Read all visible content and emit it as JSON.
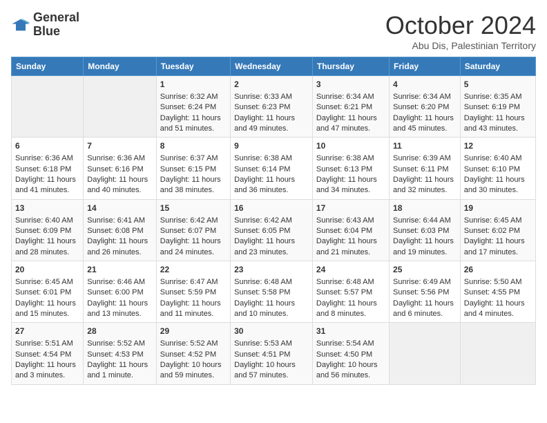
{
  "header": {
    "logo_line1": "General",
    "logo_line2": "Blue",
    "month": "October 2024",
    "location": "Abu Dis, Palestinian Territory"
  },
  "days_of_week": [
    "Sunday",
    "Monday",
    "Tuesday",
    "Wednesday",
    "Thursday",
    "Friday",
    "Saturday"
  ],
  "weeks": [
    [
      {
        "day": "",
        "info": ""
      },
      {
        "day": "",
        "info": ""
      },
      {
        "day": "1",
        "info": "Sunrise: 6:32 AM\nSunset: 6:24 PM\nDaylight: 11 hours and 51 minutes."
      },
      {
        "day": "2",
        "info": "Sunrise: 6:33 AM\nSunset: 6:23 PM\nDaylight: 11 hours and 49 minutes."
      },
      {
        "day": "3",
        "info": "Sunrise: 6:34 AM\nSunset: 6:21 PM\nDaylight: 11 hours and 47 minutes."
      },
      {
        "day": "4",
        "info": "Sunrise: 6:34 AM\nSunset: 6:20 PM\nDaylight: 11 hours and 45 minutes."
      },
      {
        "day": "5",
        "info": "Sunrise: 6:35 AM\nSunset: 6:19 PM\nDaylight: 11 hours and 43 minutes."
      }
    ],
    [
      {
        "day": "6",
        "info": "Sunrise: 6:36 AM\nSunset: 6:18 PM\nDaylight: 11 hours and 41 minutes."
      },
      {
        "day": "7",
        "info": "Sunrise: 6:36 AM\nSunset: 6:16 PM\nDaylight: 11 hours and 40 minutes."
      },
      {
        "day": "8",
        "info": "Sunrise: 6:37 AM\nSunset: 6:15 PM\nDaylight: 11 hours and 38 minutes."
      },
      {
        "day": "9",
        "info": "Sunrise: 6:38 AM\nSunset: 6:14 PM\nDaylight: 11 hours and 36 minutes."
      },
      {
        "day": "10",
        "info": "Sunrise: 6:38 AM\nSunset: 6:13 PM\nDaylight: 11 hours and 34 minutes."
      },
      {
        "day": "11",
        "info": "Sunrise: 6:39 AM\nSunset: 6:11 PM\nDaylight: 11 hours and 32 minutes."
      },
      {
        "day": "12",
        "info": "Sunrise: 6:40 AM\nSunset: 6:10 PM\nDaylight: 11 hours and 30 minutes."
      }
    ],
    [
      {
        "day": "13",
        "info": "Sunrise: 6:40 AM\nSunset: 6:09 PM\nDaylight: 11 hours and 28 minutes."
      },
      {
        "day": "14",
        "info": "Sunrise: 6:41 AM\nSunset: 6:08 PM\nDaylight: 11 hours and 26 minutes."
      },
      {
        "day": "15",
        "info": "Sunrise: 6:42 AM\nSunset: 6:07 PM\nDaylight: 11 hours and 24 minutes."
      },
      {
        "day": "16",
        "info": "Sunrise: 6:42 AM\nSunset: 6:05 PM\nDaylight: 11 hours and 23 minutes."
      },
      {
        "day": "17",
        "info": "Sunrise: 6:43 AM\nSunset: 6:04 PM\nDaylight: 11 hours and 21 minutes."
      },
      {
        "day": "18",
        "info": "Sunrise: 6:44 AM\nSunset: 6:03 PM\nDaylight: 11 hours and 19 minutes."
      },
      {
        "day": "19",
        "info": "Sunrise: 6:45 AM\nSunset: 6:02 PM\nDaylight: 11 hours and 17 minutes."
      }
    ],
    [
      {
        "day": "20",
        "info": "Sunrise: 6:45 AM\nSunset: 6:01 PM\nDaylight: 11 hours and 15 minutes."
      },
      {
        "day": "21",
        "info": "Sunrise: 6:46 AM\nSunset: 6:00 PM\nDaylight: 11 hours and 13 minutes."
      },
      {
        "day": "22",
        "info": "Sunrise: 6:47 AM\nSunset: 5:59 PM\nDaylight: 11 hours and 11 minutes."
      },
      {
        "day": "23",
        "info": "Sunrise: 6:48 AM\nSunset: 5:58 PM\nDaylight: 11 hours and 10 minutes."
      },
      {
        "day": "24",
        "info": "Sunrise: 6:48 AM\nSunset: 5:57 PM\nDaylight: 11 hours and 8 minutes."
      },
      {
        "day": "25",
        "info": "Sunrise: 6:49 AM\nSunset: 5:56 PM\nDaylight: 11 hours and 6 minutes."
      },
      {
        "day": "26",
        "info": "Sunrise: 5:50 AM\nSunset: 4:55 PM\nDaylight: 11 hours and 4 minutes."
      }
    ],
    [
      {
        "day": "27",
        "info": "Sunrise: 5:51 AM\nSunset: 4:54 PM\nDaylight: 11 hours and 3 minutes."
      },
      {
        "day": "28",
        "info": "Sunrise: 5:52 AM\nSunset: 4:53 PM\nDaylight: 11 hours and 1 minute."
      },
      {
        "day": "29",
        "info": "Sunrise: 5:52 AM\nSunset: 4:52 PM\nDaylight: 10 hours and 59 minutes."
      },
      {
        "day": "30",
        "info": "Sunrise: 5:53 AM\nSunset: 4:51 PM\nDaylight: 10 hours and 57 minutes."
      },
      {
        "day": "31",
        "info": "Sunrise: 5:54 AM\nSunset: 4:50 PM\nDaylight: 10 hours and 56 minutes."
      },
      {
        "day": "",
        "info": ""
      },
      {
        "day": "",
        "info": ""
      }
    ]
  ]
}
